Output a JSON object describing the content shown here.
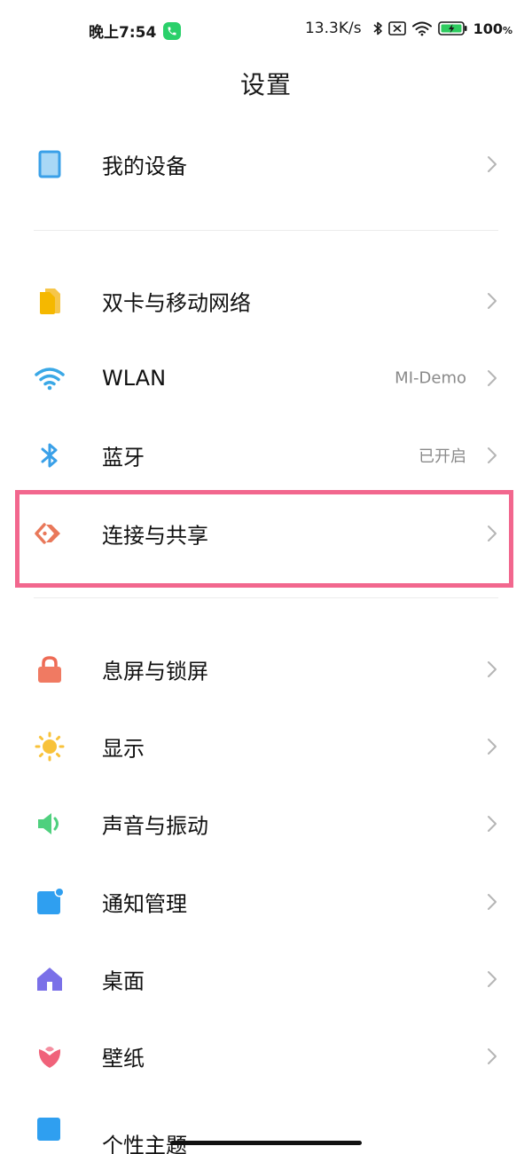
{
  "status_bar": {
    "time": "晚上7:54",
    "network_speed": "13.3K/s",
    "battery_percent": "100",
    "battery_unit": "%",
    "icons": [
      "call-badge-icon",
      "bluetooth-status-icon",
      "no-sim-icon",
      "wifi-status-icon",
      "battery-charging-icon"
    ]
  },
  "header": {
    "title": "设置"
  },
  "settings": {
    "my_device": {
      "label": "我的设备",
      "icon": "tablet-icon"
    },
    "sim": {
      "label": "双卡与移动网络",
      "icon": "sim-card-icon"
    },
    "wlan": {
      "label": "WLAN",
      "value": "MI-Demo",
      "icon": "wifi-icon"
    },
    "bluetooth": {
      "label": "蓝牙",
      "value": "已开启",
      "icon": "bluetooth-icon"
    },
    "connection": {
      "label": "连接与共享",
      "icon": "connection-share-icon"
    },
    "lock_screen": {
      "label": "息屏与锁屏",
      "icon": "lock-icon"
    },
    "display": {
      "label": "显示",
      "icon": "sun-icon"
    },
    "sound": {
      "label": "声音与振动",
      "icon": "speaker-icon"
    },
    "notifications": {
      "label": "通知管理",
      "icon": "notification-icon"
    },
    "home_screen": {
      "label": "桌面",
      "icon": "home-icon"
    },
    "wallpaper": {
      "label": "壁纸",
      "icon": "flower-icon"
    },
    "themes": {
      "label": "个性主题",
      "icon": "theme-icon"
    }
  },
  "colors": {
    "highlight": "#f2678e",
    "accent_blue": "#3aa0e8",
    "secondary_text": "#8a8a8a"
  }
}
